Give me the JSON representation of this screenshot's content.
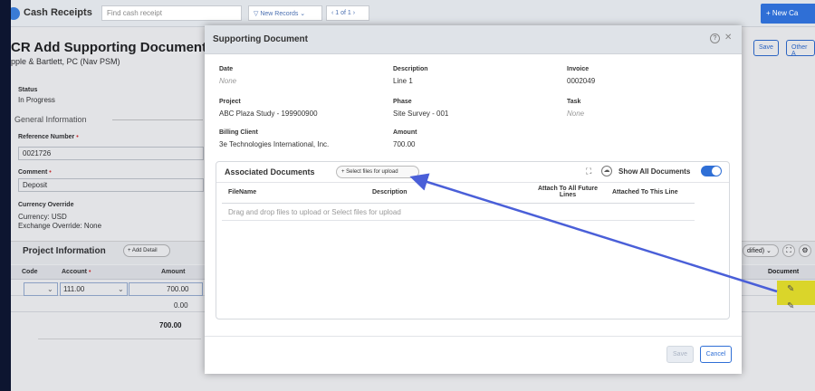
{
  "app": {
    "title": "Cash Receipts",
    "search_placeholder": "Find cash receipt",
    "filter_label": "New Records",
    "pager_label": "1 of 1",
    "new_button": "+ New Ca"
  },
  "page": {
    "title": "CR Add Supporting Documents",
    "subtitle": "pple & Bartlett, PC (Nav PSM)",
    "status_label": "Status",
    "status_value": "In Progress",
    "general_section": "General Information",
    "reference_label": "Reference Number",
    "reference_value": "0021726",
    "comment_label": "Comment",
    "comment_value": "Deposit",
    "currency_override_label": "Currency Override",
    "currency_value": "Currency: USD",
    "exchange_value": "Exchange Override: None",
    "save_button": "Save",
    "other_button": "Other A"
  },
  "project_info": {
    "title": "Project Information",
    "add_detail": "+ Add Detail",
    "modified_filter": "dified)",
    "columns": {
      "code": "Code",
      "account": "Account",
      "amount": "Amount",
      "document": "Document"
    },
    "rows": [
      {
        "account": "111.00",
        "amount": "700.00"
      },
      {
        "account": "",
        "amount": "0.00"
      }
    ],
    "total": "700.00"
  },
  "modal": {
    "title": "Supporting Document",
    "fields": {
      "date_label": "Date",
      "date_value": "None",
      "description_label": "Description",
      "description_value": "Line 1",
      "invoice_label": "Invoice",
      "invoice_value": "0002049",
      "project_label": "Project",
      "project_value": "ABC Plaza Study - 199900900",
      "phase_label": "Phase",
      "phase_value": "Site Survey - 001",
      "task_label": "Task",
      "task_value": "None",
      "billing_label": "Billing Client",
      "billing_value": "3e Technologies International, Inc.",
      "amount_label": "Amount",
      "amount_value": "700.00"
    },
    "associated": {
      "title": "Associated Documents",
      "select_files": "+ Select files for upload",
      "show_all": "Show All Documents",
      "show_all_on": true,
      "col_filename": "FileName",
      "col_description": "Description",
      "col_attach_future_1": "Attach To All Future",
      "col_attach_future_2": "Lines",
      "col_attached_line": "Attached To This Line",
      "drop_text": "Drag and drop files to upload or Select files for upload"
    },
    "save_button": "Save",
    "cancel_button": "Cancel"
  },
  "colors": {
    "accent": "#2f6fd6",
    "highlight": "#f6ef2a",
    "arrow": "#4a5fd8"
  },
  "icons": [
    "help-icon",
    "close-icon",
    "expand-icon",
    "cloud-upload-icon",
    "document-icon",
    "chevron-down-icon"
  ]
}
